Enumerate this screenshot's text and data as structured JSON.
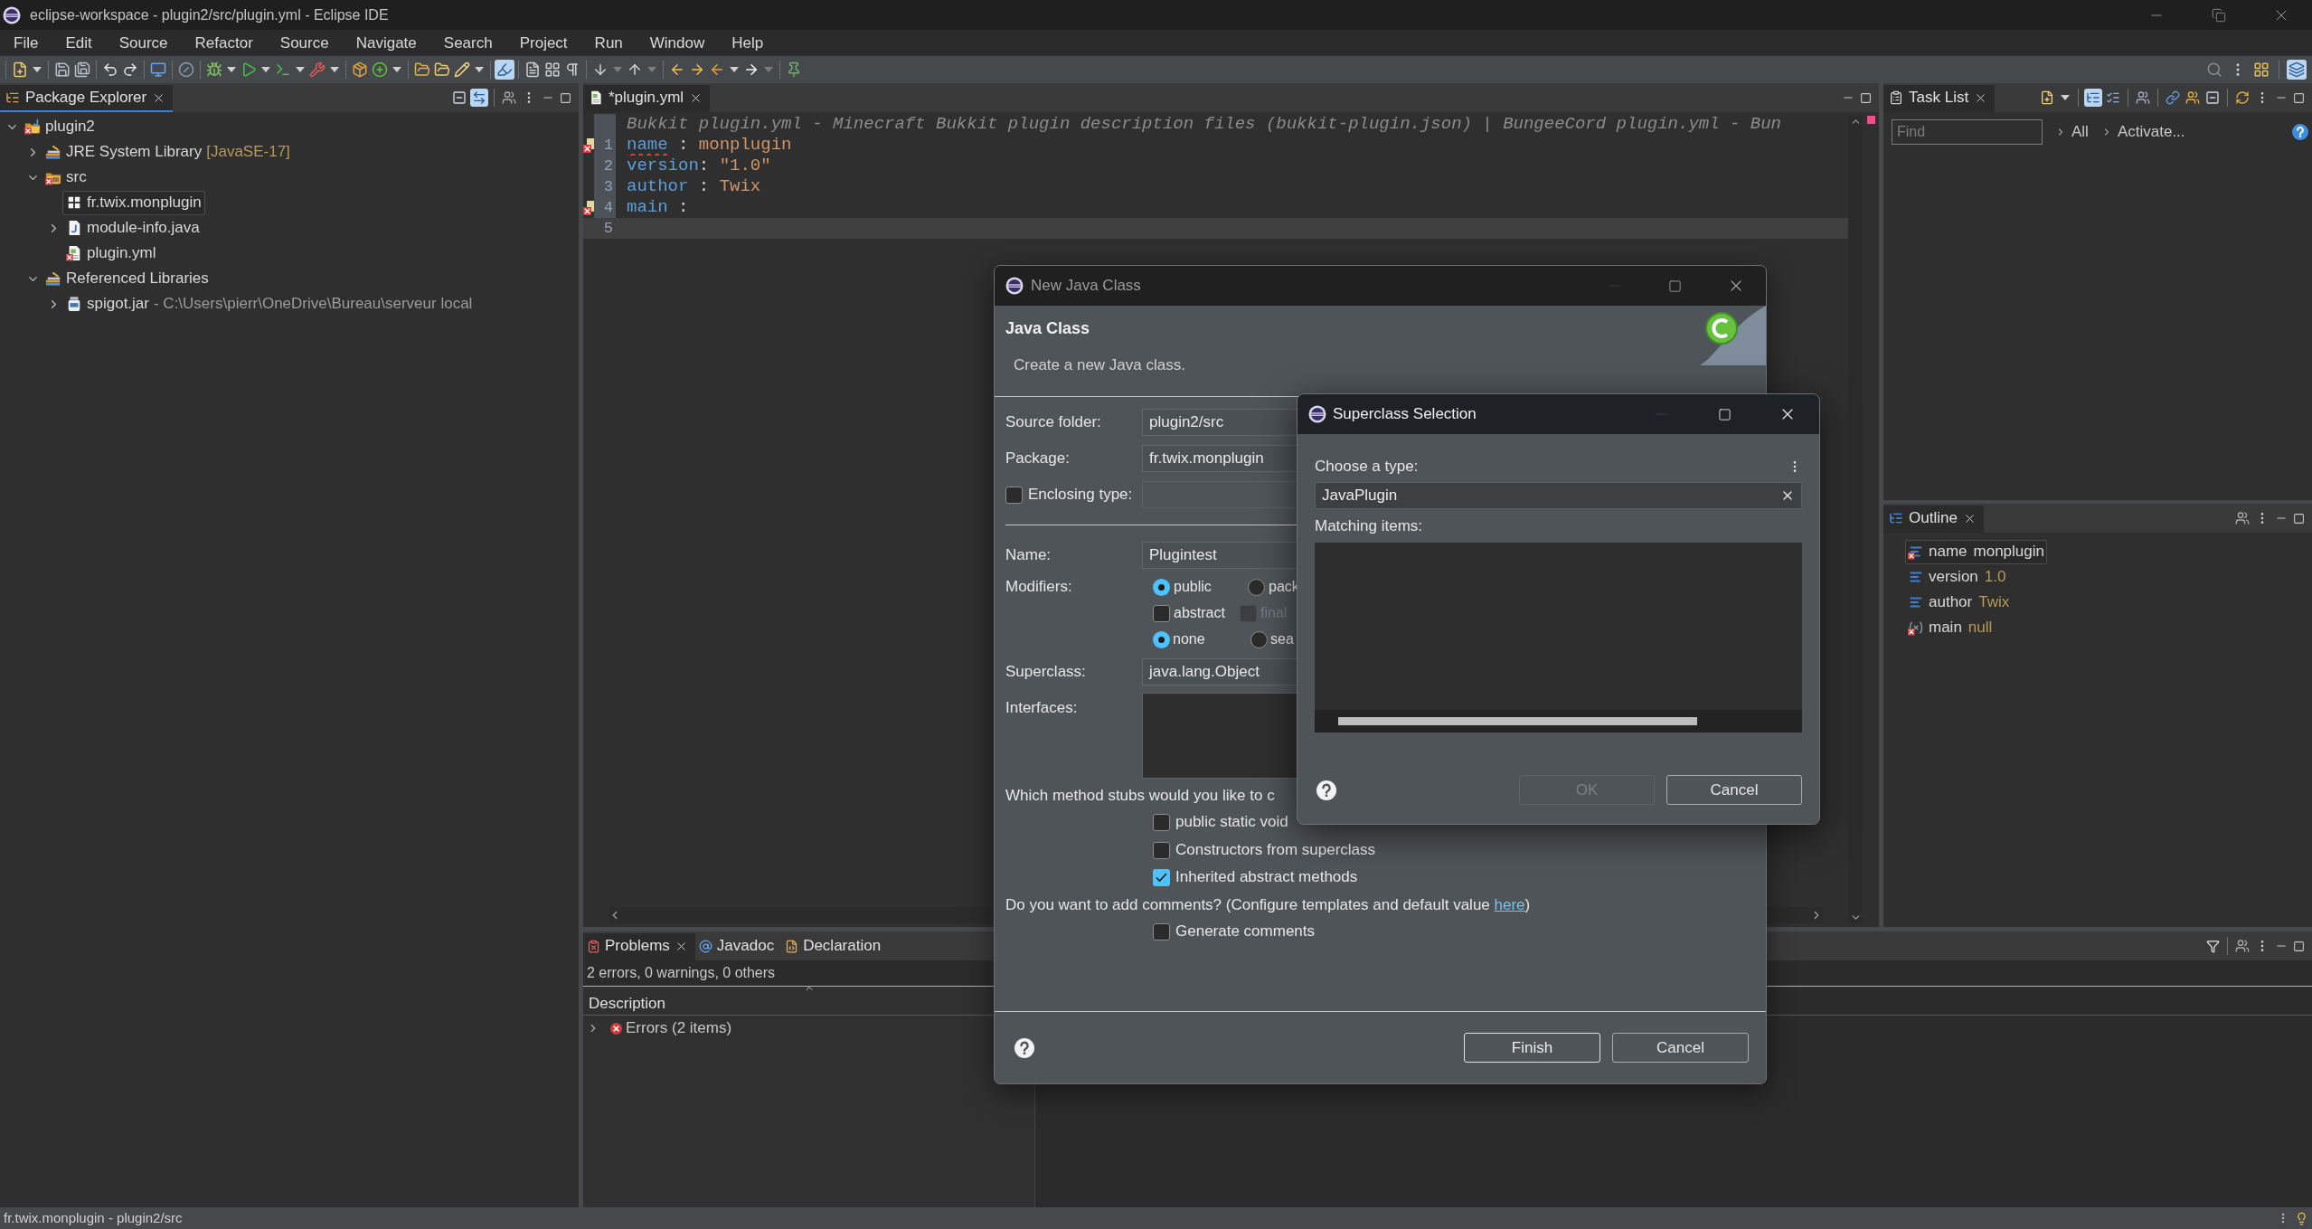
{
  "window": {
    "title": "eclipse-workspace - plugin2/src/plugin.yml - Eclipse IDE"
  },
  "menu": [
    "File",
    "Edit",
    "Source",
    "Refactor",
    "Source",
    "Navigate",
    "Search",
    "Project",
    "Run",
    "Window",
    "Help"
  ],
  "toolbar": {
    "brush_toggle": {
      "on": true
    },
    "perspective_button": {
      "on": true
    }
  },
  "package_explorer": {
    "title": "Package Explorer",
    "active": true,
    "link_toggle": {
      "on": true
    },
    "tree": [
      {
        "label": "plugin2",
        "kind": "project",
        "error": true,
        "selected": false,
        "expanded": true,
        "children": [
          {
            "label": "JRE System Library",
            "decoration": "[JavaSE-17]",
            "kind": "library",
            "error": false,
            "selected": false,
            "expanded": false
          },
          {
            "label": "src",
            "kind": "source_folder",
            "error": true,
            "selected": false,
            "expanded": true,
            "children": [
              {
                "label": "fr.twix.monplugin",
                "kind": "package",
                "error": false,
                "selected": true
              },
              {
                "label": "module-info.java",
                "kind": "java_file",
                "error": false,
                "selected": false,
                "expanded": false
              },
              {
                "label": "plugin.yml",
                "kind": "yml_file",
                "error": true,
                "selected": false
              }
            ]
          },
          {
            "label": "Referenced Libraries",
            "kind": "library",
            "error": false,
            "selected": false,
            "expanded": true,
            "children": [
              {
                "label": "spigot.jar",
                "decoration": "- C:\\Users\\pierr\\OneDrive\\Bureau\\serveur local",
                "kind": "jar",
                "error": false,
                "selected": false,
                "expanded": false
              }
            ]
          }
        ]
      }
    ]
  },
  "editor": {
    "tab": "*plugin.yml",
    "active": false,
    "header_hint": "Bukkit plugin.yml - Minecraft Bukkit plugin description files (bukkit-plugin.json) | BungeeCord plugin.yml - Bun",
    "lines": [
      {
        "number": "1",
        "error": true,
        "changed": true,
        "current": false,
        "tokens": [
          {
            "text": "name",
            "kind": "key",
            "squiggle": true
          },
          {
            "text": " : ",
            "kind": "punct",
            "squiggle": false
          },
          {
            "text": "monplugin",
            "kind": "value",
            "squiggle": false
          }
        ]
      },
      {
        "number": "2",
        "error": false,
        "changed": true,
        "current": false,
        "tokens": [
          {
            "text": "version",
            "kind": "key",
            "squiggle": false
          },
          {
            "text": ": ",
            "kind": "punct",
            "squiggle": false
          },
          {
            "text": "\"1.0\"",
            "kind": "value",
            "squiggle": false
          }
        ]
      },
      {
        "number": "3",
        "error": false,
        "changed": true,
        "current": false,
        "tokens": [
          {
            "text": "author",
            "kind": "key",
            "squiggle": false
          },
          {
            "text": " : ",
            "kind": "punct",
            "squiggle": false
          },
          {
            "text": "Twix",
            "kind": "value",
            "squiggle": false
          }
        ]
      },
      {
        "number": "4",
        "error": true,
        "changed": true,
        "current": false,
        "tokens": [
          {
            "text": "main",
            "kind": "key",
            "squiggle": false
          },
          {
            "text": " :",
            "kind": "punct",
            "squiggle": false
          }
        ]
      },
      {
        "number": "5",
        "error": false,
        "changed": false,
        "current": true
      }
    ]
  },
  "task_list": {
    "title": "Task List",
    "active": false,
    "tree_toggle": {
      "on": true
    },
    "find": {
      "placeholder": "Find"
    },
    "links": [
      "All",
      "Activate..."
    ]
  },
  "outline": {
    "title": "Outline",
    "active": false,
    "items": [
      {
        "label": "name",
        "value": "monplugin",
        "kind": "string",
        "error": true,
        "selected": true
      },
      {
        "label": "version",
        "value": "1.0",
        "kind": "string",
        "error": false,
        "selected": false
      },
      {
        "label": "author",
        "value": "Twix",
        "kind": "string",
        "error": false,
        "selected": false
      },
      {
        "label": "main",
        "value": "null",
        "kind": "null",
        "error": true,
        "selected": false
      }
    ]
  },
  "problems": {
    "active": false,
    "tabs": [
      {
        "label": "Problems",
        "kind": "problems",
        "selected": true
      },
      {
        "label": "Javadoc",
        "kind": "javadoc",
        "selected": false
      },
      {
        "label": "Declaration",
        "kind": "declaration",
        "selected": false
      }
    ],
    "summary": "2 errors, 0 warnings, 0 others",
    "columns": [
      "Description"
    ],
    "rows": [
      {
        "label": "Errors (2 items)",
        "expanded": false
      }
    ]
  },
  "status_bar": {
    "text": "fr.twix.monplugin - plugin2/src"
  },
  "new_class_dialog": {
    "title": "New Java Class",
    "heading": "Java Class",
    "description": "Create a new Java class.",
    "source_folder": {
      "label": "Source folder:",
      "value": "plugin2/src"
    },
    "package": {
      "label": "Package:",
      "value": "fr.twix.monplugin"
    },
    "enclosing_type": {
      "label": "Enclosing type:",
      "checked": false
    },
    "name": {
      "label": "Name:",
      "value": "Plugintest"
    },
    "modifiers": {
      "label": "Modifiers:",
      "access": [
        {
          "label": "public",
          "selected": true
        },
        {
          "label": "pack",
          "selected": false
        }
      ],
      "flags": [
        {
          "label": "abstract",
          "checked": false,
          "disabled": false
        },
        {
          "label": "final",
          "checked": false,
          "disabled": true
        }
      ],
      "extension": [
        {
          "label": "none",
          "selected": true
        },
        {
          "label": "sea",
          "selected": false
        }
      ]
    },
    "superclass": {
      "label": "Superclass:",
      "value": "java.lang.Object"
    },
    "interfaces": {
      "label": "Interfaces:"
    },
    "stubs": {
      "question": "Which method stubs would you like to c",
      "options": [
        {
          "label": "public static void",
          "checked": false
        },
        {
          "label": "Constructors from superclass",
          "checked": false
        },
        {
          "label": "Inherited abstract methods",
          "checked": true
        }
      ]
    },
    "comments": {
      "question": "Do you want to add comments? (Configure templates and default value ",
      "link": "here",
      "question_end": ")",
      "option": {
        "label": "Generate comments",
        "checked": false
      }
    },
    "buttons": [
      {
        "label": "Finish",
        "default": true
      },
      {
        "label": "Cancel",
        "default": false
      }
    ]
  },
  "superclass_dialog": {
    "title": "Superclass Selection",
    "prompt": "Choose a type:",
    "search": {
      "value": "JavaPlugin"
    },
    "matching_label": "Matching items:",
    "buttons": [
      {
        "label": "OK",
        "disabled": true
      },
      {
        "label": "Cancel",
        "disabled": false
      }
    ]
  }
}
